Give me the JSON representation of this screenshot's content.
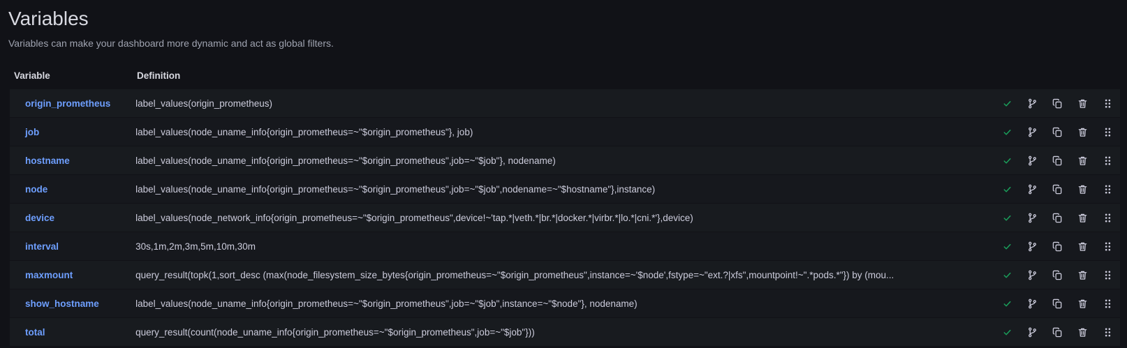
{
  "header": {
    "title": "Variables",
    "subtitle": "Variables can make your dashboard more dynamic and act as global filters."
  },
  "table": {
    "columns": {
      "variable": "Variable",
      "definition": "Definition"
    },
    "rows": [
      {
        "name": "origin_prometheus",
        "definition": "label_values(origin_prometheus)"
      },
      {
        "name": "job",
        "definition": "label_values(node_uname_info{origin_prometheus=~\"$origin_prometheus\"}, job)"
      },
      {
        "name": "hostname",
        "definition": "label_values(node_uname_info{origin_prometheus=~\"$origin_prometheus\",job=~\"$job\"}, nodename)"
      },
      {
        "name": "node",
        "definition": "label_values(node_uname_info{origin_prometheus=~\"$origin_prometheus\",job=~\"$job\",nodename=~\"$hostname\"},instance)"
      },
      {
        "name": "device",
        "definition": "label_values(node_network_info{origin_prometheus=~\"$origin_prometheus\",device!~'tap.*|veth.*|br.*|docker.*|virbr.*|lo.*|cni.*'},device)"
      },
      {
        "name": "interval",
        "definition": "30s,1m,2m,3m,5m,10m,30m"
      },
      {
        "name": "maxmount",
        "definition": "query_result(topk(1,sort_desc (max(node_filesystem_size_bytes{origin_prometheus=~\"$origin_prometheus\",instance=~'$node',fstype=~\"ext.?|xfs\",mountpoint!~\".*pods.*\"}) by (mou..."
      },
      {
        "name": "show_hostname",
        "definition": "label_values(node_uname_info{origin_prometheus=~\"$origin_prometheus\",job=~\"$job\",instance=~\"$node\"}, nodename)"
      },
      {
        "name": "total",
        "definition": "query_result(count(node_uname_info{origin_prometheus=~\"$origin_prometheus\",job=~\"$job\"}))"
      }
    ],
    "row_actions": [
      "check-icon",
      "branch-icon",
      "copy-icon",
      "trash-icon",
      "drag-handle-icon"
    ]
  },
  "colors": {
    "background": "#111217",
    "row_background": "#181b1f",
    "variable_link": "#6e9fff",
    "check": "#1a9e5a"
  }
}
